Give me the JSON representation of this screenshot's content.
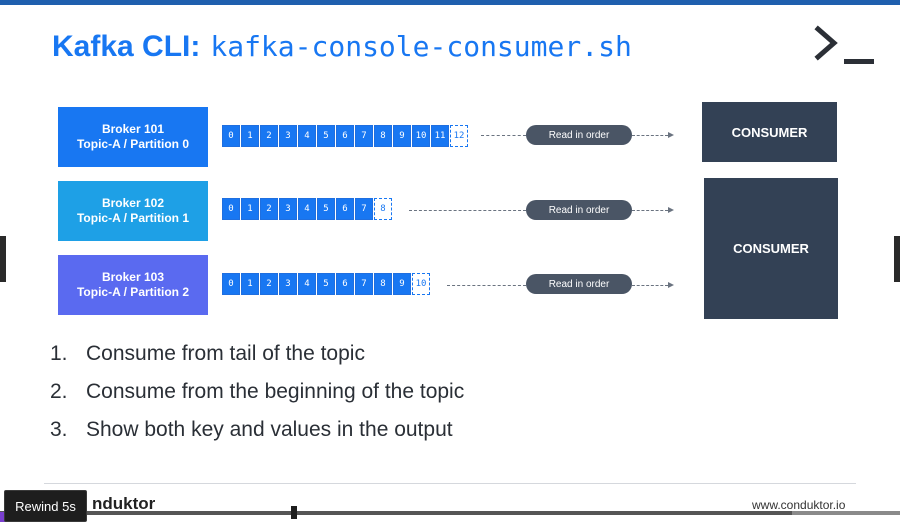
{
  "slide": {
    "title_prefix": "Kafka CLI:",
    "title_command": "kafka-console-consumer.sh",
    "prompt_icon": "terminal-prompt-icon"
  },
  "diagram": {
    "rows": [
      {
        "broker_label": "Broker 101",
        "partition_label": "Topic-A / Partition 0",
        "color": "#1877f2",
        "offsets": [
          "0",
          "1",
          "2",
          "3",
          "4",
          "5",
          "6",
          "7",
          "8",
          "9",
          "10",
          "11",
          "12"
        ],
        "next_offset_hollow": "12",
        "arrow_label": "Read in order"
      },
      {
        "broker_label": "Broker 102",
        "partition_label": "Topic-A / Partition 1",
        "color": "#1ea0e6",
        "offsets": [
          "0",
          "1",
          "2",
          "3",
          "4",
          "5",
          "6",
          "7",
          "8"
        ],
        "next_offset_hollow": "8",
        "arrow_label": "Read in order"
      },
      {
        "broker_label": "Broker 103",
        "partition_label": "Topic-A / Partition 2",
        "color": "#5a6af0",
        "offsets": [
          "0",
          "1",
          "2",
          "3",
          "4",
          "5",
          "6",
          "7",
          "8",
          "9",
          "10"
        ],
        "next_offset_hollow": "10",
        "arrow_label": "Read in order"
      }
    ],
    "consumers": [
      {
        "label": "CONSUMER"
      },
      {
        "label": "CONSUMER"
      }
    ]
  },
  "list": [
    {
      "num": "1.",
      "text": "Consume from tail of the topic"
    },
    {
      "num": "2.",
      "text": "Consume from the beginning of the topic"
    },
    {
      "num": "3.",
      "text": "Show both key and values in the output"
    }
  ],
  "footer": {
    "logo_text": "nduktor",
    "url": "www.conduktor.io"
  },
  "player": {
    "rewind_label": "Rewind 5s",
    "progress_percent": 88
  }
}
